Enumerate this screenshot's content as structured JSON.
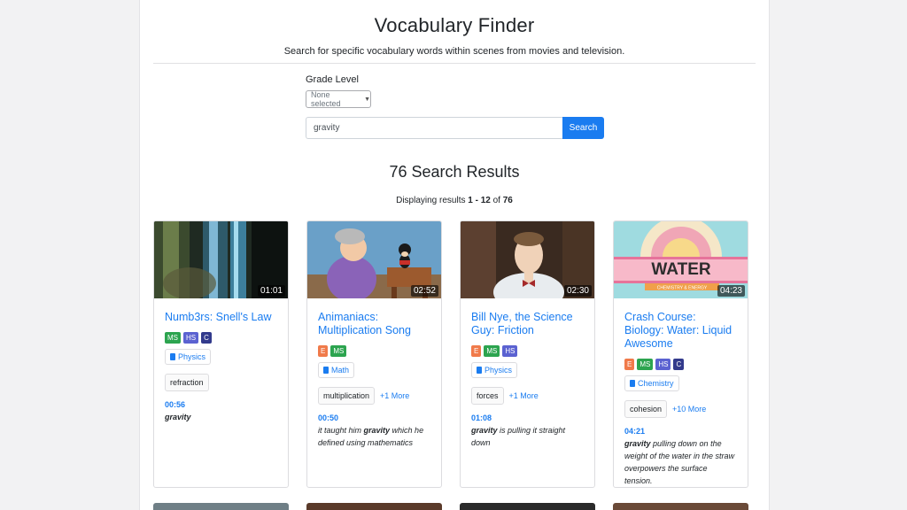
{
  "header": {
    "title": "Vocabulary Finder",
    "subtitle": "Search for specific vocabulary words within scenes from movies and television."
  },
  "filters": {
    "grade_label": "Grade Level",
    "grade_selected": "None selected"
  },
  "search": {
    "value": "gravity",
    "button_label": "Search"
  },
  "results": {
    "title": "76 Search Results",
    "displaying_prefix": "Displaying results ",
    "range": "1 - 12",
    "of_text": " of ",
    "total": "76"
  },
  "colors": {
    "accent": "#1a7cf0",
    "grade_E": "#f07a4a",
    "grade_MS": "#2ca44f",
    "grade_HS": "#5b62d1",
    "grade_C": "#323a8c"
  },
  "cards": [
    {
      "duration": "01:01",
      "title": "Numb3rs: Snell's Law",
      "grades": [
        "MS",
        "HS",
        "C"
      ],
      "subject": "Physics",
      "keyword": "refraction",
      "more": "",
      "time": "00:56",
      "quote_pre": "",
      "quote_word": "gravity",
      "quote_post": ""
    },
    {
      "duration": "02:52",
      "title": "Animaniacs: Multiplication Song",
      "grades": [
        "E",
        "MS"
      ],
      "subject": "Math",
      "keyword": "multiplication",
      "more": "+1 More",
      "time": "00:50",
      "quote_pre": "it taught him ",
      "quote_word": "gravity",
      "quote_post": " which he defined using mathematics"
    },
    {
      "duration": "02:30",
      "title": "Bill Nye, the Science Guy: Friction",
      "grades": [
        "E",
        "MS",
        "HS"
      ],
      "subject": "Physics",
      "keyword": "forces",
      "more": "+1 More",
      "time": "01:08",
      "quote_pre": "",
      "quote_word": "gravity",
      "quote_post": " is pulling it straight down"
    },
    {
      "duration": "04:23",
      "title": "Crash Course: Biology: Water: Liquid Awesome",
      "grades": [
        "E",
        "MS",
        "HS",
        "C"
      ],
      "subject": "Chemistry",
      "keyword": "cohesion",
      "more": "+10 More",
      "time": "04:21",
      "quote_pre": "",
      "quote_word": "gravity",
      "quote_post": " pulling down on the weight of the water in the straw overpowers the surface tension.",
      "thumb_text": "WATER",
      "thumb_sub": "CHEMISTRY & ENERGY"
    }
  ]
}
